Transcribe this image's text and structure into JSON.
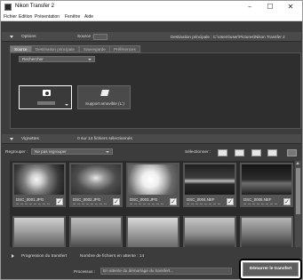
{
  "window": {
    "title": "Nikon Transfer 2",
    "controls": [
      "–",
      "☐",
      "✕"
    ]
  },
  "menu": [
    "Fichier",
    "Edition",
    "Présentation",
    "Fenêtre",
    "Aide"
  ],
  "options": {
    "header_label": "Options",
    "source_label": "Source :",
    "destination_label": "Destination principale : C:\\Users\\user\\Pictures\\Nikon Transfer 2",
    "tabs": [
      "Source",
      "Destination principale",
      "Sauvegarde",
      "Préférences"
    ],
    "search_label": "Rechercher",
    "devices": [
      {
        "label": "",
        "icon": "camera-icon",
        "selected": true
      },
      {
        "label": "Support amovible (L:)",
        "icon": "removable-drive-icon",
        "selected": false
      }
    ]
  },
  "thumbnails": {
    "header_label": "Vignettes",
    "count_text": "0 sur 14 fichiers sélectionnés",
    "group_label": "Regrouper :",
    "group_value": "Ne pas regrouper",
    "select_label": "Sélectionner :",
    "items": [
      {
        "name": "DSC_0001.JPG",
        "checked": true
      },
      {
        "name": "DSC_0002.JPG",
        "checked": true
      },
      {
        "name": "DSC_0003.JPG",
        "checked": true
      },
      {
        "name": "DSC_0004.NEF",
        "checked": true
      },
      {
        "name": "DSC_0005.NEF",
        "checked": true
      }
    ]
  },
  "transfer": {
    "header_label": "Progression du transfert",
    "queue_text": "Nombre de fichiers en attente : 14",
    "process_label": "Processus :",
    "process_value": "En attente du démarrage du transfert...",
    "start_button": "Démarrer le transfert"
  },
  "colors": {
    "window_bg": "#3c3c3c",
    "panel_header": "#4a4a4a",
    "accent_border": "#000000"
  }
}
